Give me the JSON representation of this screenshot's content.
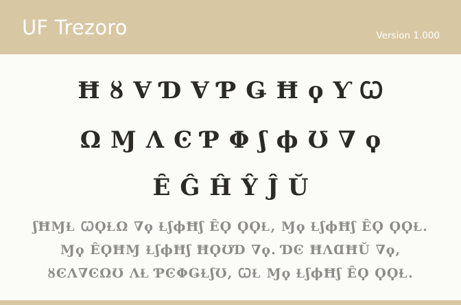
{
  "header": {
    "font_name": "UF Trezoro",
    "version": "Version 1.000"
  },
  "glyphs": {
    "row1": [
      "Ħ",
      "ȣ",
      "Ɐ",
      "Ɗ",
      "Ɐ",
      "Ƥ",
      "Ǥ",
      "Ħ",
      "ϙ",
      "Ƴ",
      "Ꞷ"
    ],
    "row2": [
      "Ω",
      "Ɱ",
      "Λ",
      "Ͼ",
      "Ƥ",
      "Φ",
      "ʃ",
      "ϕ",
      "Ʊ",
      "∇",
      "ϙ"
    ],
    "row3": [
      "Ȇ",
      "Ĝ",
      "Ĥ",
      "Ŷ",
      "Ĵ",
      "Ŭ"
    ]
  },
  "sample_text": [
    "ʃĦⱮⱢ ꞶϘⱢΩ ∇ϙ ⱢʃϕĦʃ ȆϘ ϘϘⱢ, Ɱϙ ⱢʃϕĦʃ ȆϘ ϘϘⱢ.",
    "Ɱϙ ȆϘĦⱮ ⱢʃϕĦʃ ĦϘƱƊ ∇ϙ. ƊϾ ĦΛⱭĦŬ ∇ϙ,",
    "ȣϾΛ∇ϾΩƱ ΛⱢ ƤϾΦǤⱢʃƱ, ꞶⱢ Ɱϙ ⱢʃϕĦʃ ȆϘ ϘϘⱢ."
  ],
  "colors": {
    "accent": "#d8c7a3",
    "glyph": "#2b2a25",
    "sample": "#8d8c88",
    "background": "#fbfbf8"
  }
}
